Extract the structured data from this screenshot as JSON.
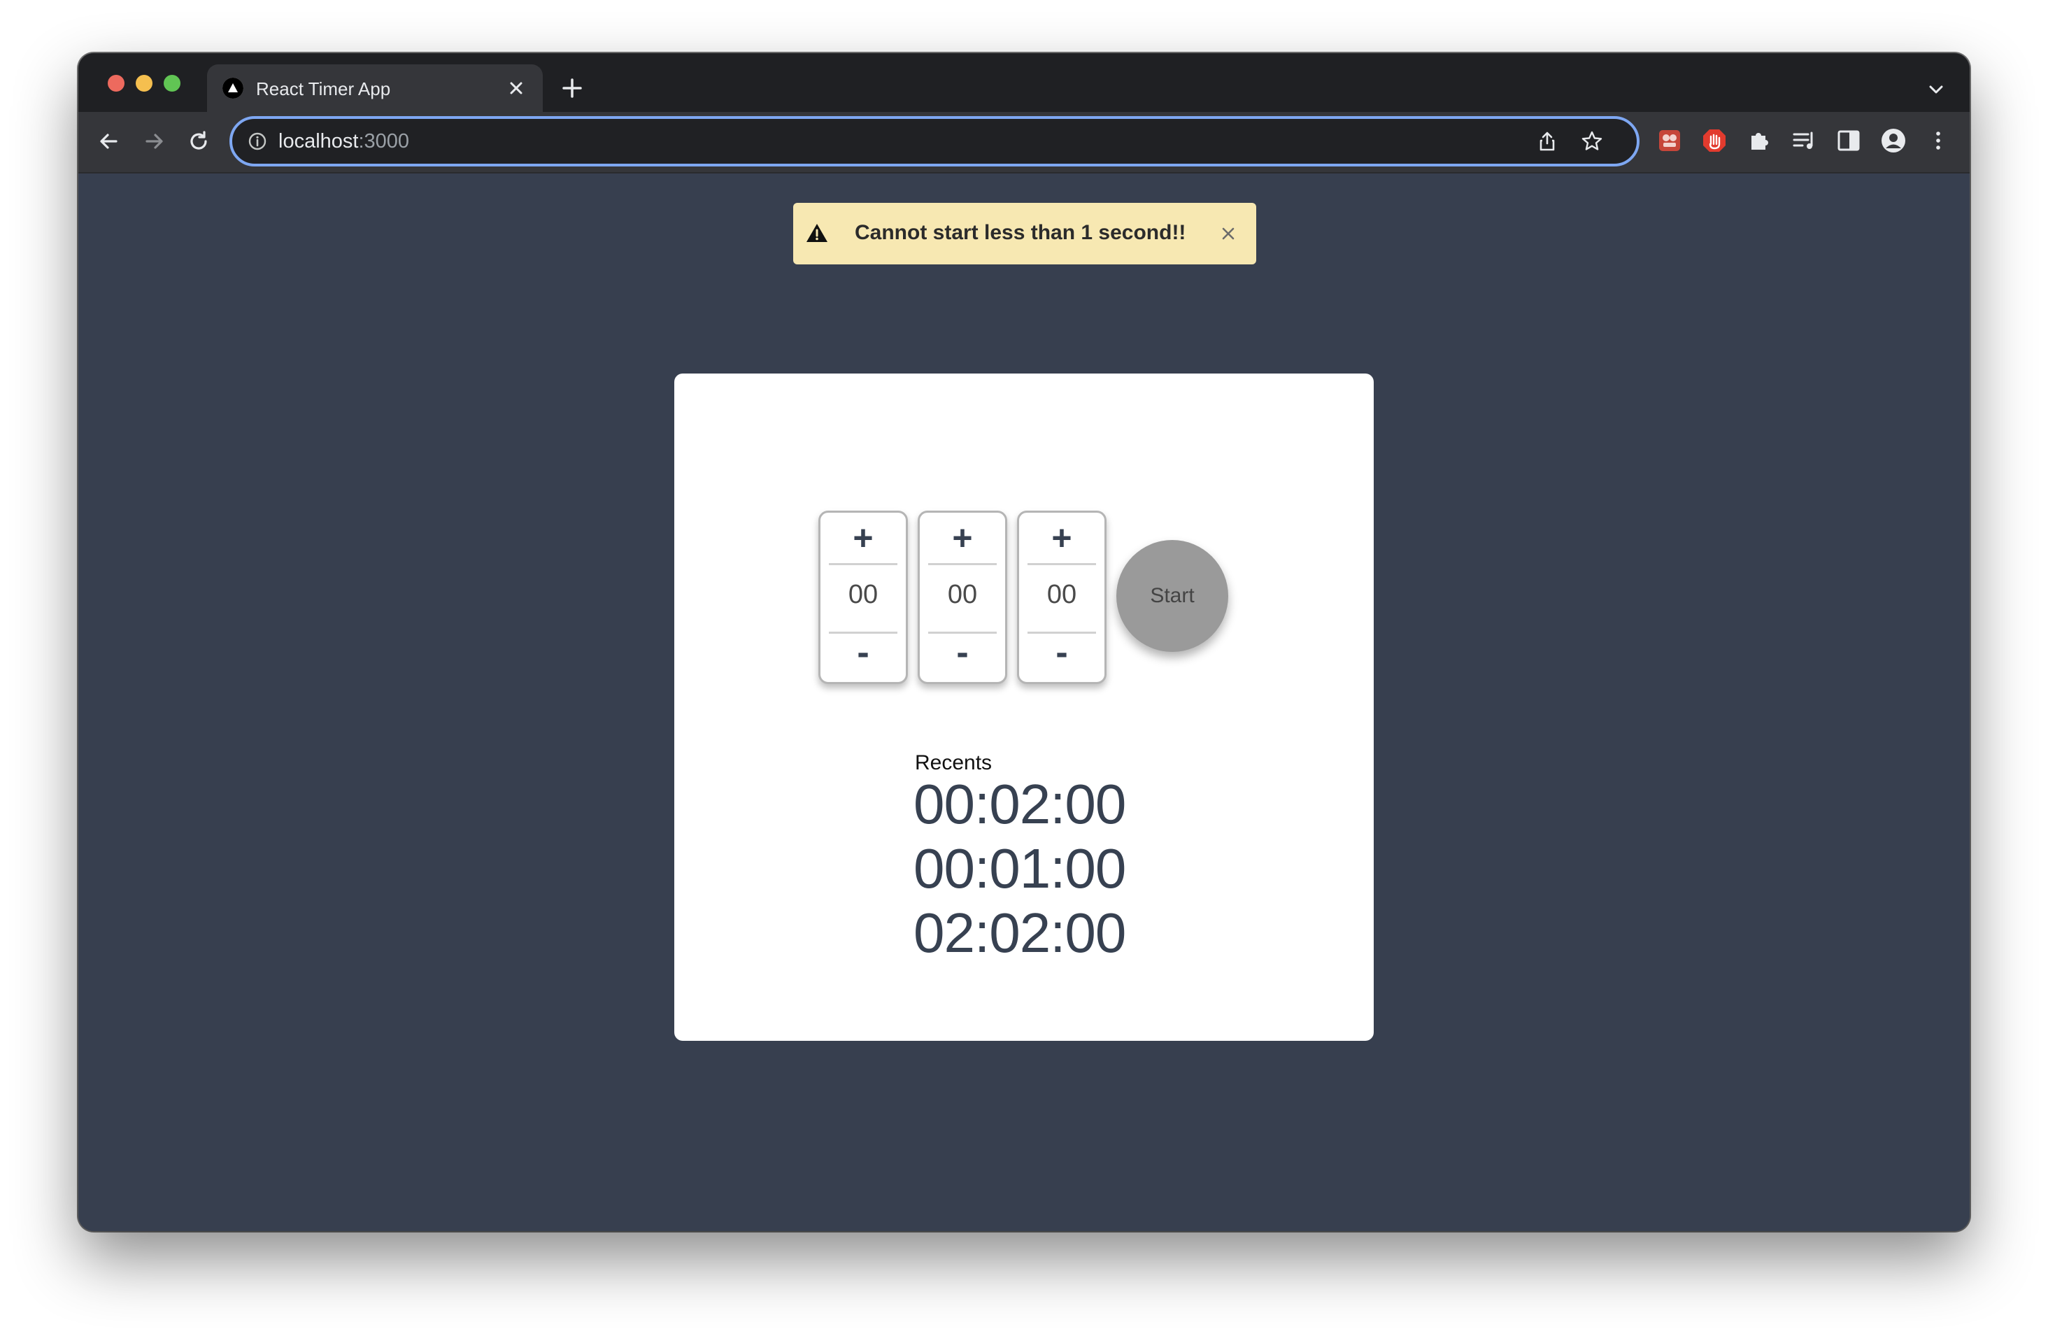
{
  "browser": {
    "tab_title": "React Timer App",
    "url_host": "localhost",
    "url_port": ":3000"
  },
  "toast": {
    "message": "Cannot start less than 1 second!!"
  },
  "timer": {
    "hours": "00",
    "minutes": "00",
    "seconds": "00",
    "increment_label": "+",
    "decrement_label": "-",
    "start_label": "Start"
  },
  "recents": {
    "title": "Recents",
    "items": [
      "00:02:00",
      "00:01:00",
      "02:02:00"
    ]
  }
}
